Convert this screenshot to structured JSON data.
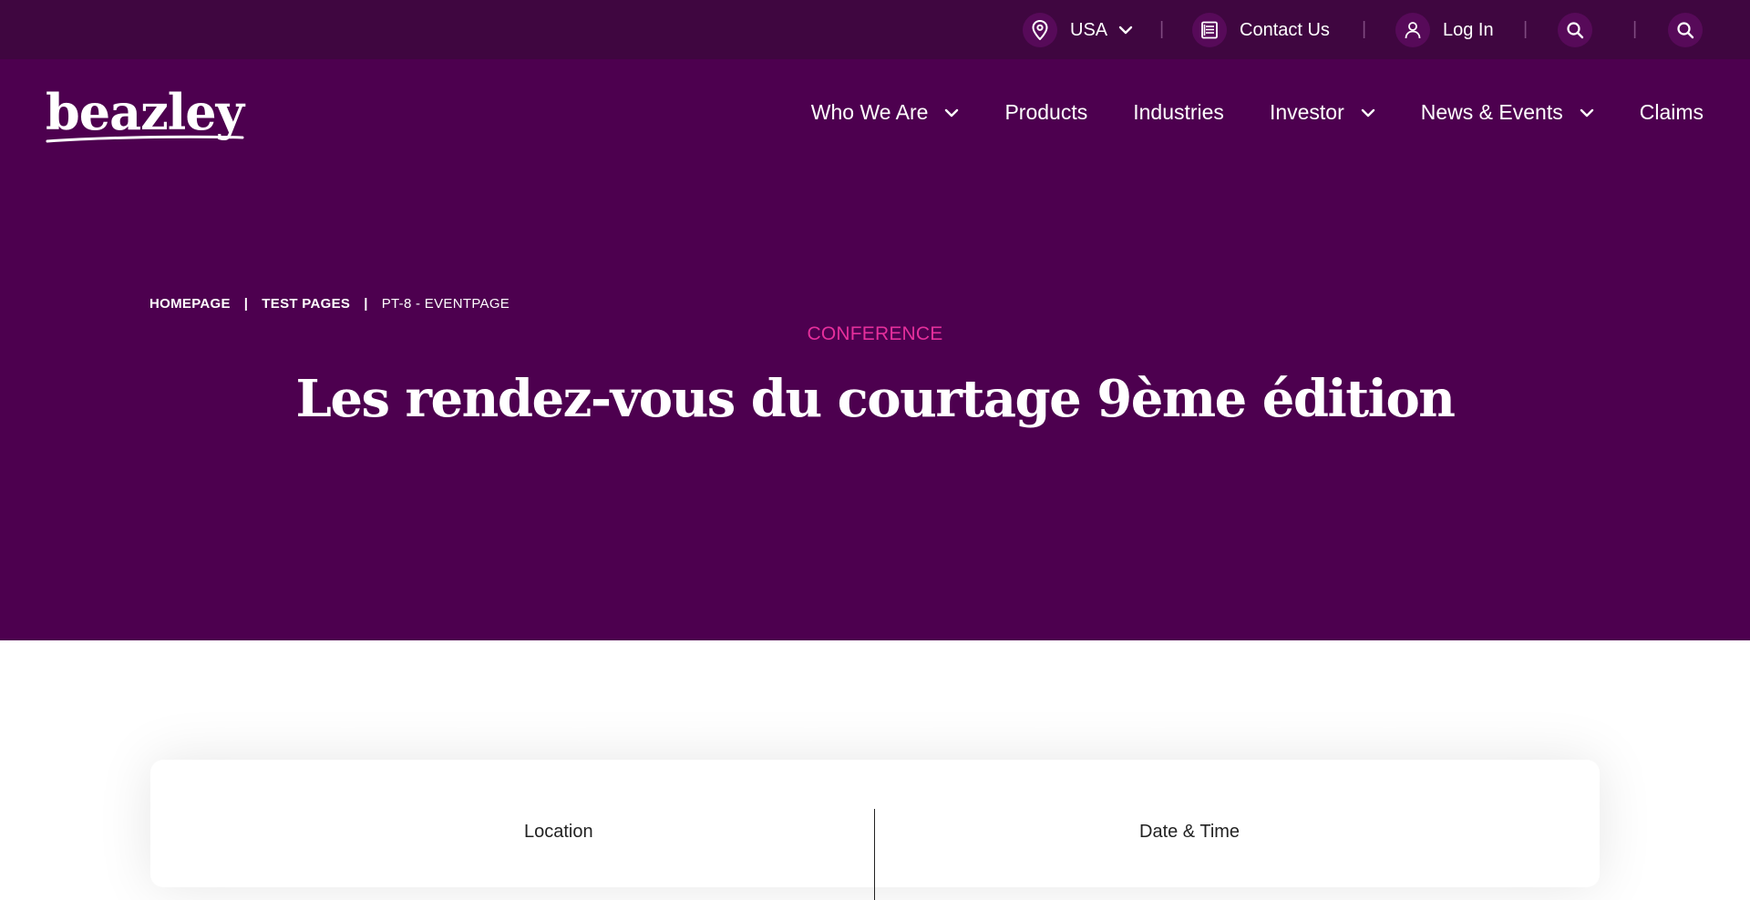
{
  "utility": {
    "region_label": "USA",
    "contact_label": "Contact Us",
    "login_label": "Log In",
    "separator": "|"
  },
  "logo": {
    "text": "beazley"
  },
  "nav": {
    "items": [
      {
        "label": "Who We Are",
        "dropdown": true
      },
      {
        "label": "Products",
        "dropdown": false
      },
      {
        "label": "Industries",
        "dropdown": false
      },
      {
        "label": "Investor",
        "dropdown": true
      },
      {
        "label": "News & Events",
        "dropdown": true
      },
      {
        "label": "Claims",
        "dropdown": false
      }
    ]
  },
  "breadcrumb": {
    "items": [
      "HOMEPAGE",
      "TEST PAGES"
    ],
    "current": "PT-8 - EVENTPAGE",
    "separator": "|"
  },
  "hero": {
    "eyebrow": "CONFERENCE",
    "title": "Les rendez-vous du courtage 9ème édition"
  },
  "details": {
    "location_label": "Location",
    "datetime_label": "Date & Time"
  },
  "colors": {
    "utility_bg": "#3f0640",
    "hero_bg": "#4d004f",
    "accent_pink": "#e52f9c"
  },
  "icons": {
    "location": "map-pin-icon",
    "contact": "contact-book-icon",
    "login": "user-icon",
    "search": "search-icon",
    "chevron": "chevron-down-icon"
  }
}
